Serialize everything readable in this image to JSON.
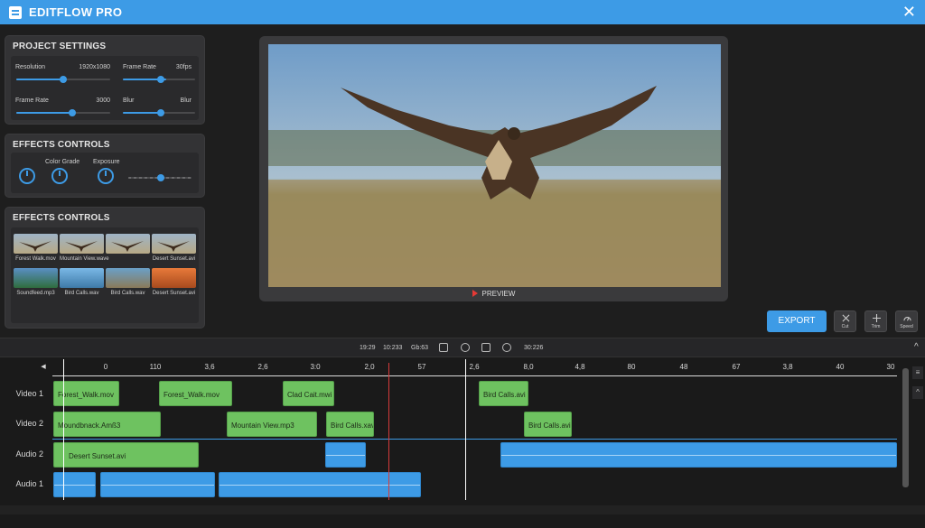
{
  "app": {
    "title": "EDITFLOW PRO"
  },
  "project_settings": {
    "title": "PROJECT SETTINGS",
    "rows": [
      {
        "label": "Resolution",
        "value": "1920x1080",
        "level": 0.5
      },
      {
        "label": "Frame Rate",
        "value": "30fps",
        "level": 0.6
      },
      {
        "label": "Frame Rate",
        "value": "3000",
        "level": 0.6
      },
      {
        "label": "Blur",
        "value": "Blur",
        "level": 0.55
      }
    ]
  },
  "effects_controls": {
    "title": "EFFECTS CONTROLS",
    "knob_labels": [
      "Color Grade",
      "Exposure"
    ],
    "slider_level": 0.5
  },
  "media_browser": {
    "title": "EFFECTS CONTROLS",
    "items": [
      {
        "caption": "Forest Walk.mov"
      },
      {
        "caption": "Mountain View.wave"
      },
      {
        "caption": ""
      },
      {
        "caption": "Desert Sunset.avi"
      },
      {
        "caption": "Soundfeed.mp3"
      },
      {
        "caption": "Bird Calls.wav"
      },
      {
        "caption": "Bird Calls.wav"
      },
      {
        "caption": "Desert Sunset.avi"
      }
    ]
  },
  "preview": {
    "label": "PREVIEW"
  },
  "toolbar": {
    "export_label": "EXPORT",
    "tools": [
      {
        "label": "Cut",
        "icon": "cut-icon"
      },
      {
        "label": "Trim",
        "icon": "trim-icon"
      },
      {
        "label": "Speed",
        "icon": "speed-icon"
      }
    ]
  },
  "timeline": {
    "timecode_a": "19:29",
    "timecode_b": "10:233",
    "timecode_c": "Gb:63",
    "timecode_d": "30:226",
    "ticks": [
      "0",
      "110",
      "3,6",
      "2,6",
      "3:0",
      "2,0",
      "57",
      "2,6",
      "8,0",
      "4,8",
      "80",
      "48",
      "67",
      "3,8",
      "40",
      "30"
    ],
    "tracks": [
      {
        "label": "Video 1",
        "clips": [
          {
            "name": "Forest_Walk.mov"
          },
          {
            "name": "Forest_Walk.mov"
          },
          {
            "name": "Clad Cait.mwi"
          },
          {
            "name": "Bird Calls.avi"
          }
        ]
      },
      {
        "label": "Video 2",
        "clips": [
          {
            "name": "Moundbnack.Amß3"
          },
          {
            "name": "Mountain View.mp3"
          },
          {
            "name": "Bird Calls.xav"
          },
          {
            "name": "Bird Calls.avi"
          }
        ]
      },
      {
        "label": "Audio 2",
        "clips": [
          {
            "name": "Desert Sunset.avi"
          }
        ]
      },
      {
        "label": "Audio 1",
        "clips": []
      }
    ]
  },
  "colors": {
    "accent": "#3d9be6",
    "video_clip": "#6ec260",
    "audio_clip": "#3d9be6",
    "playhead_red": "#d63a3a"
  }
}
